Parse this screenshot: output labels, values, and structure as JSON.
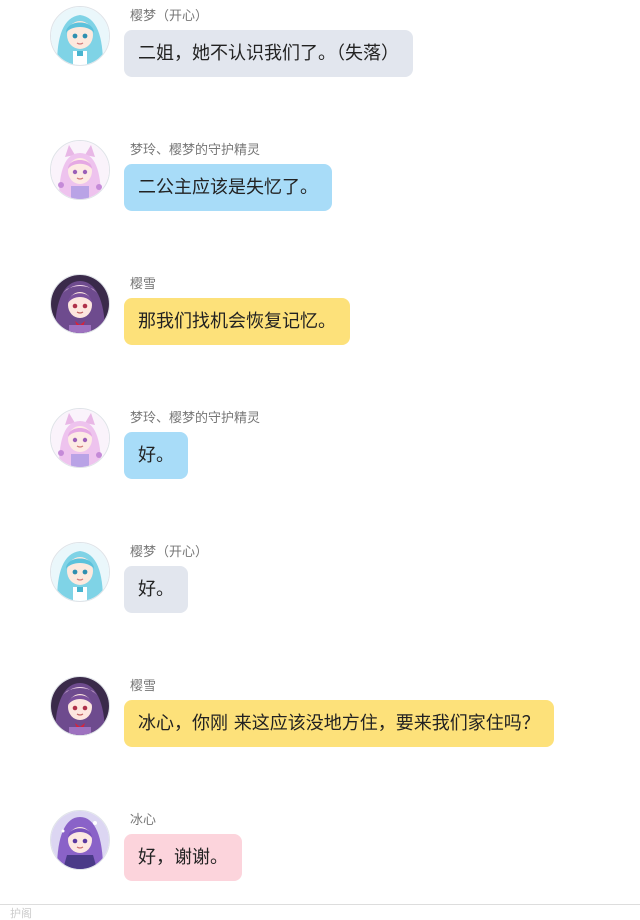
{
  "messages": [
    {
      "speaker": "樱梦（开心）",
      "text": "二姐，她不认识我们了。（失落）",
      "avatar": "cyan-twin-tail-girl-avatar",
      "bubble_color": "#e2e6ee"
    },
    {
      "speaker": "梦玲、樱梦的守护精灵",
      "text": "二公主应该是失忆了。",
      "avatar": "pink-cat-ear-girl-avatar",
      "bubble_color": "#a8dcf8"
    },
    {
      "speaker": "樱雪",
      "text": "那我们找机会恢复记忆。",
      "avatar": "purple-hair-girl-avatar",
      "bubble_color": "#fde17a"
    },
    {
      "speaker": "梦玲、樱梦的守护精灵",
      "text": "好。",
      "avatar": "pink-cat-ear-girl-avatar",
      "bubble_color": "#a8dcf8"
    },
    {
      "speaker": "樱梦（开心）",
      "text": "好。",
      "avatar": "cyan-twin-tail-girl-avatar",
      "bubble_color": "#e2e6ee"
    },
    {
      "speaker": "樱雪",
      "text": "冰心，你刚 来这应该没地方住，要来我们家住吗？",
      "avatar": "purple-hair-girl-avatar",
      "bubble_color": "#fde17a"
    },
    {
      "speaker": "冰心",
      "text": "好，谢谢。",
      "avatar": "violet-hair-girl-avatar",
      "bubble_color": "#fcd4dc"
    }
  ],
  "footer": {
    "text": "护阁"
  }
}
